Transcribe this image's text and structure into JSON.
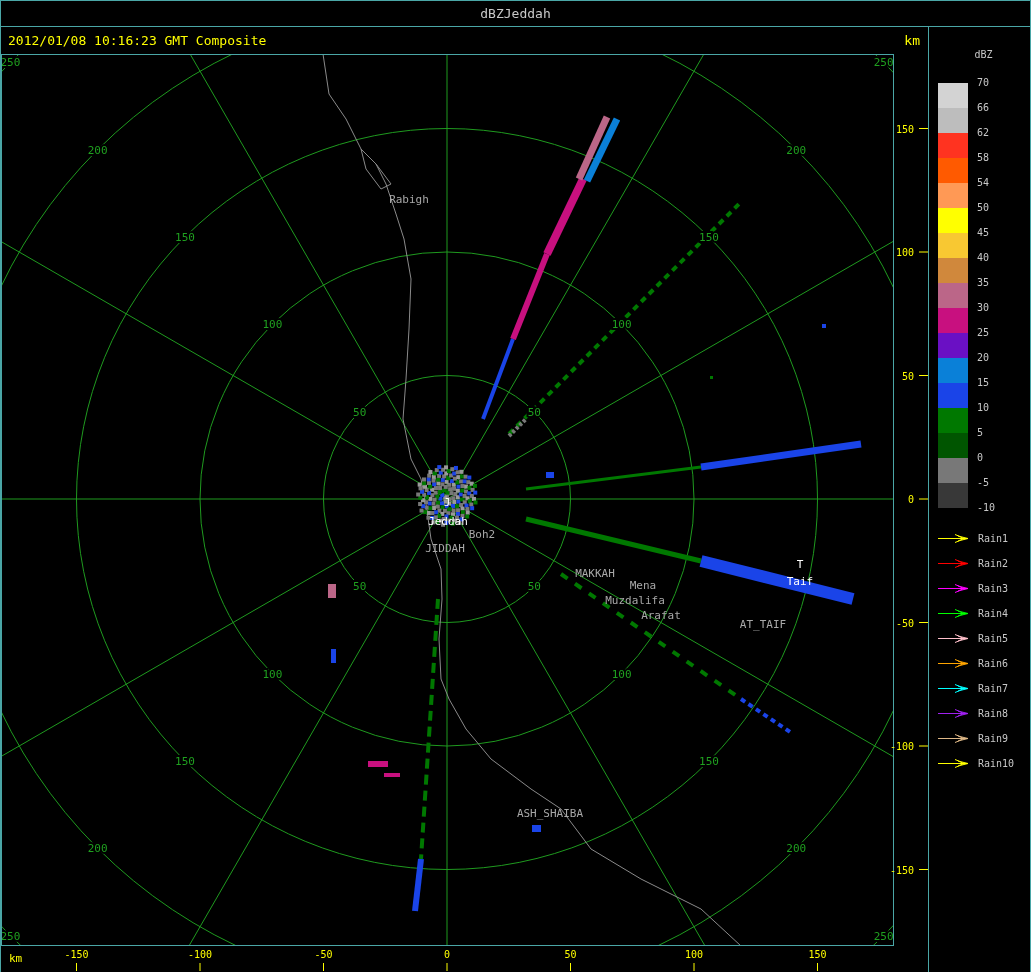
{
  "window": {
    "title": "dBZJeddah"
  },
  "header": {
    "timestamp": "2012/01/08 10:16:23 GMT Composite"
  },
  "map": {
    "ring_labels": [
      "50",
      "50",
      "50",
      "50",
      "100",
      "100",
      "100",
      "100",
      "150",
      "150",
      "150",
      "150",
      "200",
      "200",
      "200",
      "200",
      "250",
      "250",
      "250",
      "250"
    ],
    "places": [
      {
        "label": "Rabigh",
        "kind": "town"
      },
      {
        "label": "J",
        "kind": "site"
      },
      {
        "label": "Jeddah",
        "kind": "site"
      },
      {
        "label": "Boh2",
        "kind": "town"
      },
      {
        "label": "JIDDAH",
        "kind": "town"
      },
      {
        "label": "MAKKAH",
        "kind": "town"
      },
      {
        "label": "Mena",
        "kind": "town"
      },
      {
        "label": "Muzdalifa",
        "kind": "town"
      },
      {
        "label": "Arafat",
        "kind": "town"
      },
      {
        "label": "T",
        "kind": "site"
      },
      {
        "label": "Taif",
        "kind": "site"
      },
      {
        "label": "AT_TAIF",
        "kind": "town"
      },
      {
        "label": "ASH_SHAIBA",
        "kind": "town"
      }
    ]
  },
  "x_axis": {
    "unit": "km",
    "ticks": [
      "-150",
      "-100",
      "-50",
      "0",
      "50",
      "100",
      "150"
    ]
  },
  "y_axis": {
    "unit": "km",
    "ticks": [
      "150",
      "100",
      "50",
      "0",
      "-50",
      "-100",
      "-150"
    ]
  },
  "legend": {
    "title": "dBZ",
    "labels": [
      "70",
      "66",
      "62",
      "58",
      "54",
      "50",
      "45",
      "40",
      "35",
      "30",
      "25",
      "20",
      "15",
      "10",
      "5",
      "0",
      "-5",
      "-10"
    ],
    "bands": [
      {
        "color": "#d3d3d3"
      },
      {
        "color": "#bdbdbd"
      },
      {
        "color": "#ff3320"
      },
      {
        "color": "#ff5a00"
      },
      {
        "color": "#ff9955"
      },
      {
        "color": "#ffff00"
      },
      {
        "color": "#f8c832"
      },
      {
        "color": "#d0883c"
      },
      {
        "color": "#bb6688"
      },
      {
        "color": "#c8107f"
      },
      {
        "color": "#6a10c4"
      },
      {
        "color": "#0a80d8"
      },
      {
        "color": "#1a44e8"
      },
      {
        "color": "#007800"
      },
      {
        "color": "#005500"
      },
      {
        "color": "#787878"
      },
      {
        "color": "#383838"
      }
    ]
  },
  "tracks": [
    {
      "label": "Rain1",
      "color": "#ffff00"
    },
    {
      "label": "Rain2",
      "color": "#ff0000"
    },
    {
      "label": "Rain3",
      "color": "#ff00ff"
    },
    {
      "label": "Rain4",
      "color": "#00ff00"
    },
    {
      "label": "Rain5",
      "color": "#ffc0cb"
    },
    {
      "label": "Rain6",
      "color": "#ffa500"
    },
    {
      "label": "Rain7",
      "color": "#00ffff"
    },
    {
      "label": "Rain8",
      "color": "#a020f0"
    },
    {
      "label": "Rain9",
      "color": "#deb887"
    },
    {
      "label": "Rain10",
      "color": "#ffff00"
    }
  ]
}
